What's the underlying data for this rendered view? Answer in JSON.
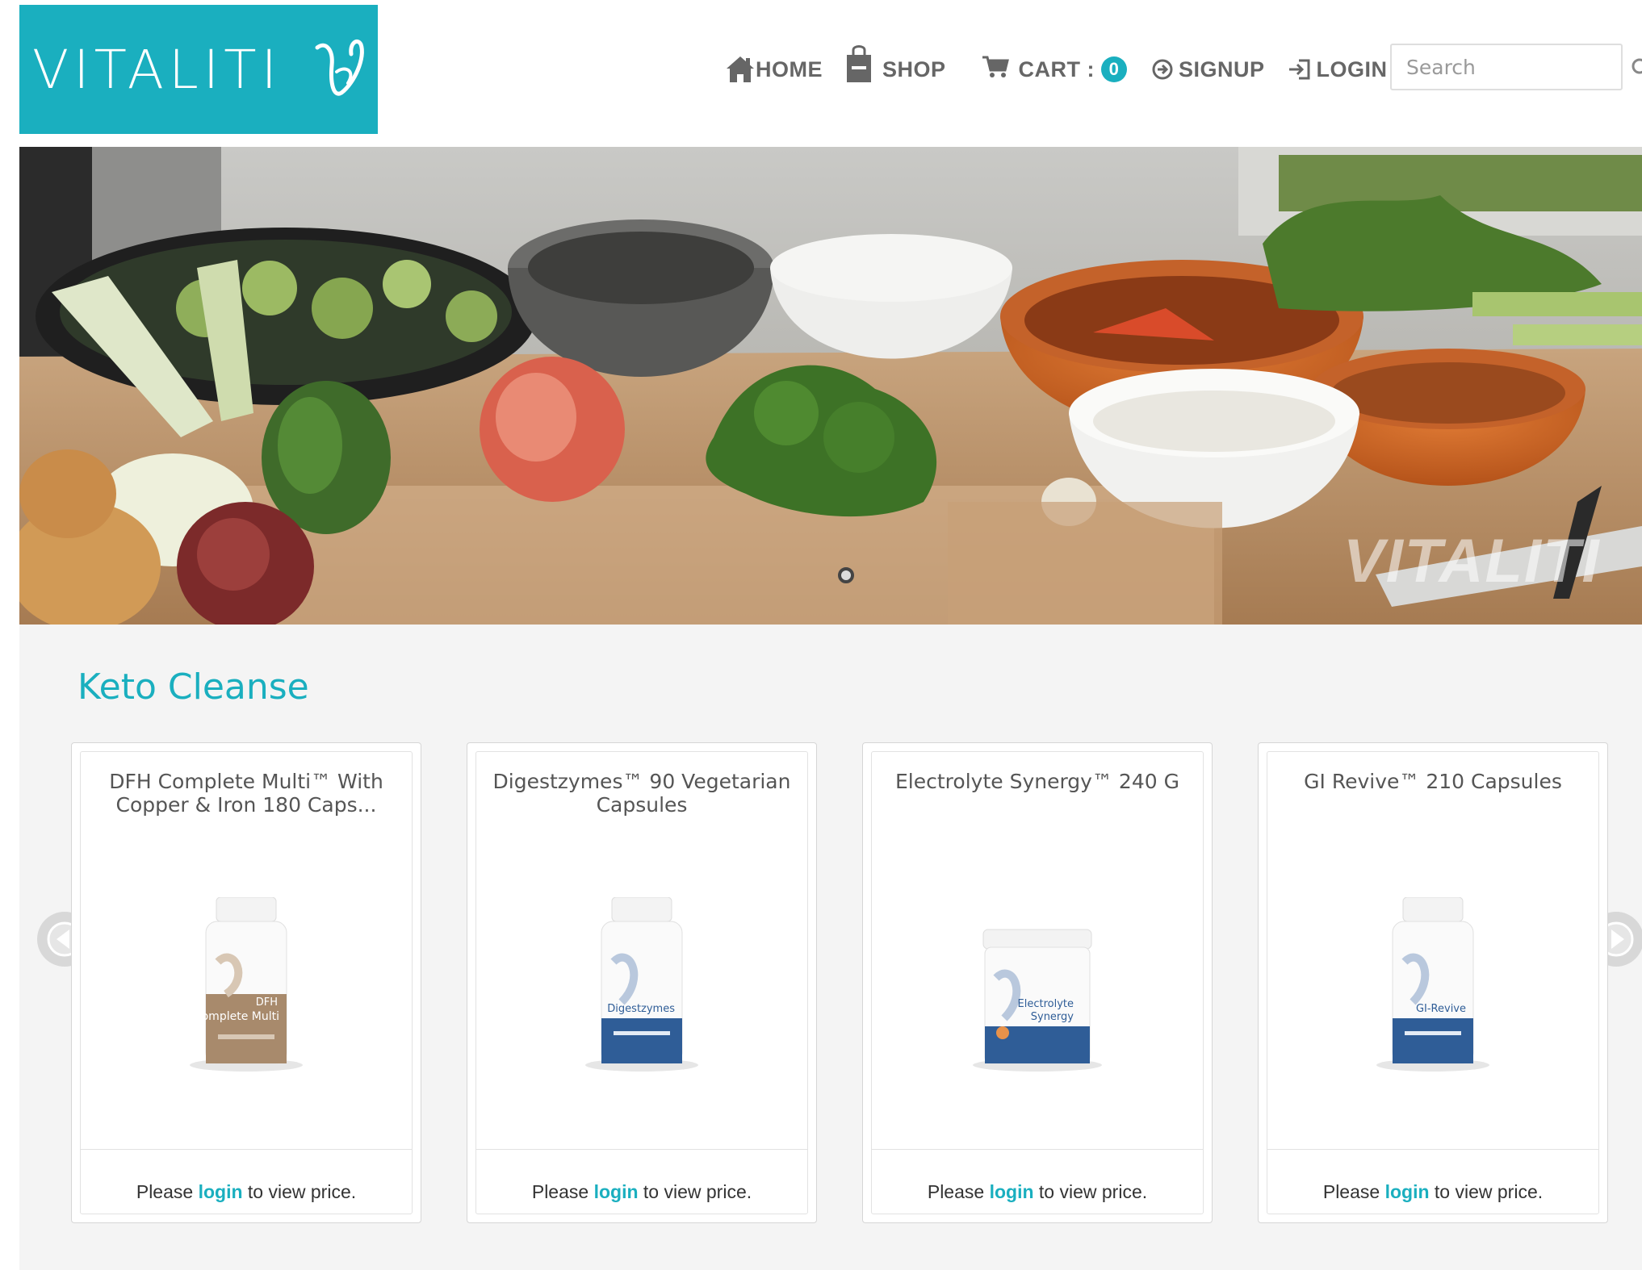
{
  "brand": {
    "name": "VITALITI",
    "colors": {
      "accent": "#1aafbf",
      "nav_text": "#666666",
      "section_bg": "#f4f4f4"
    }
  },
  "nav": {
    "home": "HOME",
    "shop": "SHOP",
    "cart_label": "CART :",
    "cart_count": "0",
    "signup": "SIGNUP",
    "login": "LOGIN",
    "icons": [
      "home-icon",
      "shopping-bag-icon",
      "cart-icon",
      "signup-icon",
      "login-icon",
      "search-icon"
    ]
  },
  "search": {
    "placeholder": "Search",
    "value": ""
  },
  "hero": {
    "watermark": "VITALITI",
    "slide_count": 1,
    "active_slide": 1
  },
  "section": {
    "title": "Keto Cleanse"
  },
  "products": [
    {
      "name": "DFH Complete Multi™ With Copper & Iron 180 Caps...",
      "label_line1": "DFH",
      "label_line2": "Complete Multi",
      "label_color": "#a88a6c",
      "price_prefix": "Please",
      "price_link": "login",
      "price_suffix": "to view price."
    },
    {
      "name": "Digestzymes™ 90 Vegetarian Capsules",
      "label_line1": "",
      "label_line2": "Digestzymes",
      "label_color": "#2f5d97",
      "price_prefix": "Please",
      "price_link": "login",
      "price_suffix": "to view price."
    },
    {
      "name": "Electrolyte Synergy™ 240 G",
      "label_line1": "Electrolyte",
      "label_line2": "Synergy",
      "label_color": "#2f5d97",
      "price_prefix": "Please",
      "price_link": "login",
      "price_suffix": "to view price."
    },
    {
      "name": "GI Revive™ 210 Capsules",
      "label_line1": "",
      "label_line2": "GI-Revive",
      "label_color": "#2f5d97",
      "price_prefix": "Please",
      "price_link": "login",
      "price_suffix": "to view price."
    }
  ],
  "carousel": {
    "prev_icon": "chevron-left-icon",
    "next_icon": "chevron-right-icon"
  }
}
